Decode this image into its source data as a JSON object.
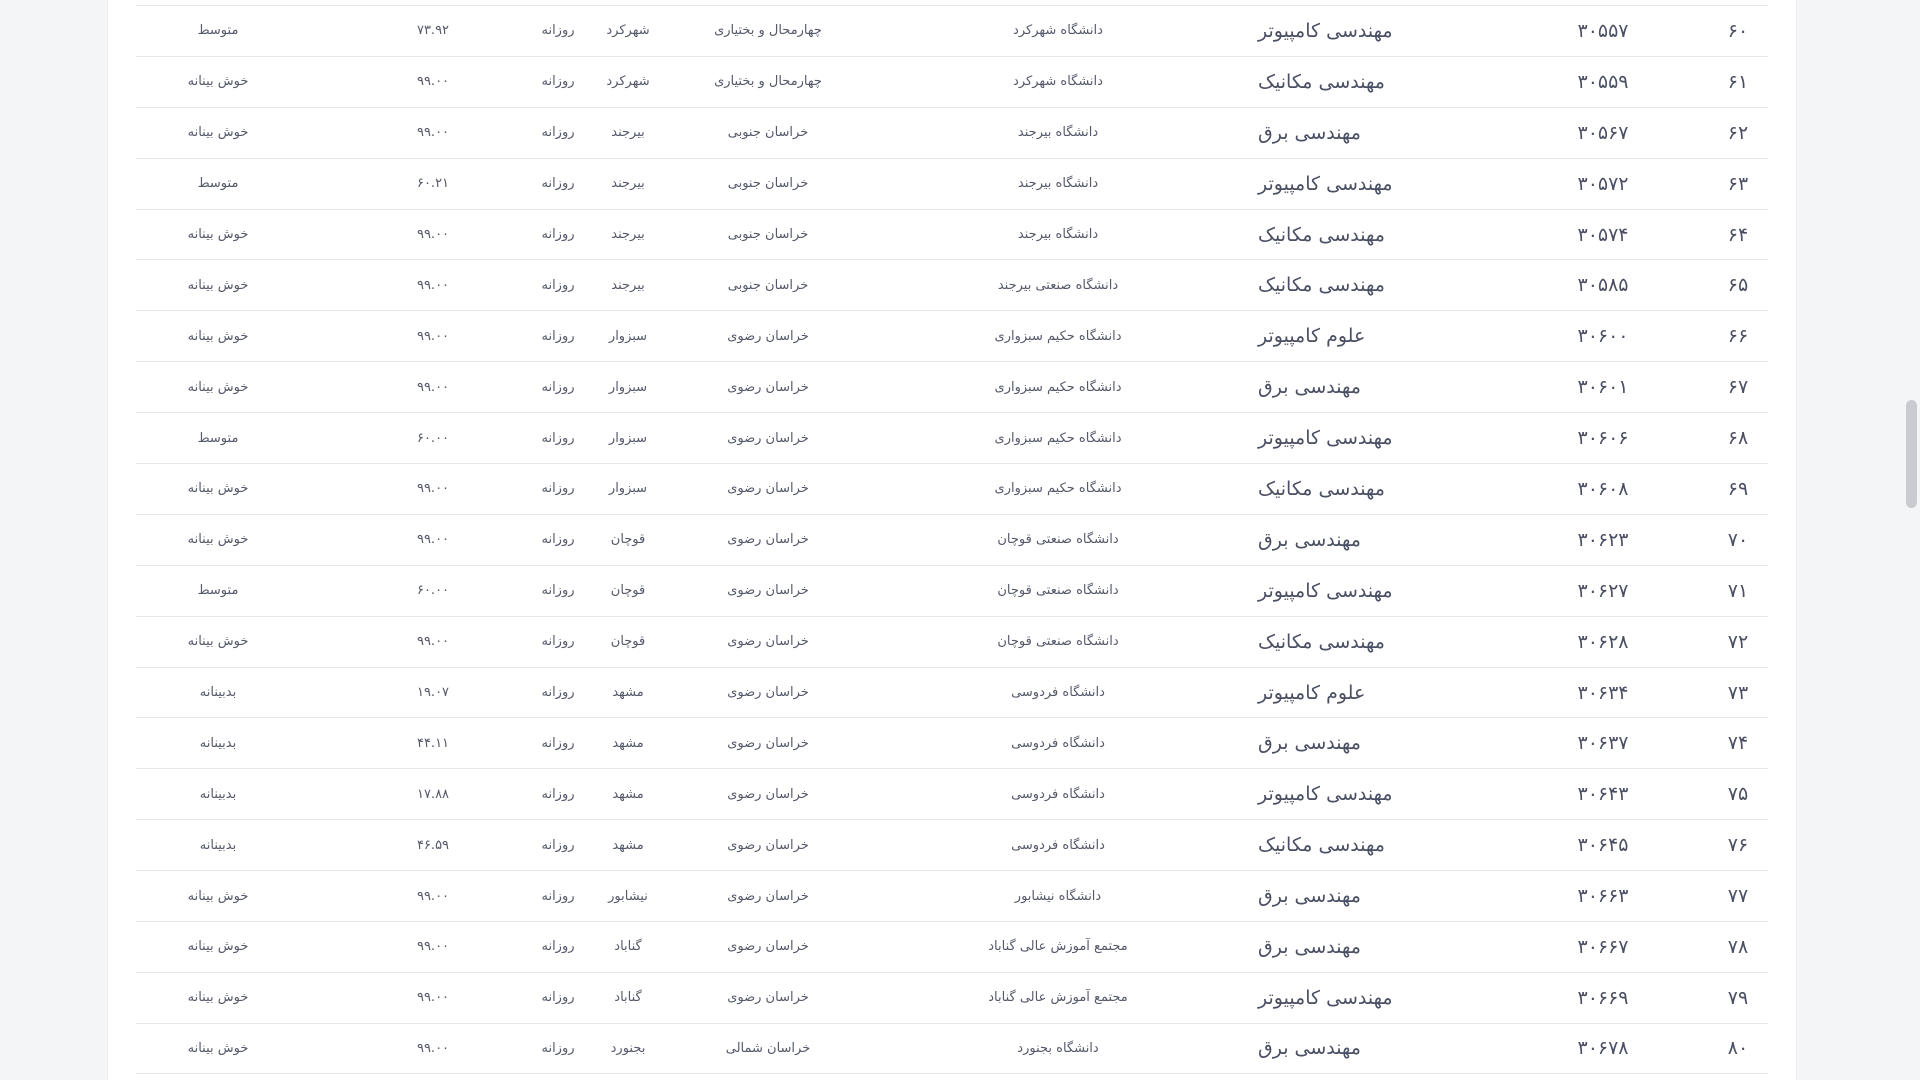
{
  "table": {
    "rows": [
      {
        "idx": "۶۰",
        "code": "۳۰۵۵۷",
        "field": "مهندسی کامپیوتر",
        "university": "دانشگاه شهرکرد",
        "province": "چهارمحال و بختیاری",
        "city": "شهرکرد",
        "type": "روزانه",
        "score": "۷۳.۹۲",
        "status": "متوسط"
      },
      {
        "idx": "۶۱",
        "code": "۳۰۵۵۹",
        "field": "مهندسی مکانیک",
        "university": "دانشگاه شهرکرد",
        "province": "چهارمحال و بختیاری",
        "city": "شهرکرد",
        "type": "روزانه",
        "score": "۹۹.۰۰",
        "status": "خوش بینانه"
      },
      {
        "idx": "۶۲",
        "code": "۳۰۵۶۷",
        "field": "مهندسی برق",
        "university": "دانشگاه بیرجند",
        "province": "خراسان جنوبی",
        "city": "بیرجند",
        "type": "روزانه",
        "score": "۹۹.۰۰",
        "status": "خوش بینانه"
      },
      {
        "idx": "۶۳",
        "code": "۳۰۵۷۲",
        "field": "مهندسی کامپیوتر",
        "university": "دانشگاه بیرجند",
        "province": "خراسان جنوبی",
        "city": "بیرجند",
        "type": "روزانه",
        "score": "۶۰.۲۱",
        "status": "متوسط"
      },
      {
        "idx": "۶۴",
        "code": "۳۰۵۷۴",
        "field": "مهندسی مکانیک",
        "university": "دانشگاه بیرجند",
        "province": "خراسان جنوبی",
        "city": "بیرجند",
        "type": "روزانه",
        "score": "۹۹.۰۰",
        "status": "خوش بینانه"
      },
      {
        "idx": "۶۵",
        "code": "۳۰۵۸۵",
        "field": "مهندسی مکانیک",
        "university": "دانشگاه صنعتی بیرجند",
        "province": "خراسان جنوبی",
        "city": "بیرجند",
        "type": "روزانه",
        "score": "۹۹.۰۰",
        "status": "خوش بینانه"
      },
      {
        "idx": "۶۶",
        "code": "۳۰۶۰۰",
        "field": "علوم کامپیوتر",
        "university": "دانشگاه حکیم سبزواری",
        "province": "خراسان رضوی",
        "city": "سبزوار",
        "type": "روزانه",
        "score": "۹۹.۰۰",
        "status": "خوش بینانه"
      },
      {
        "idx": "۶۷",
        "code": "۳۰۶۰۱",
        "field": "مهندسی برق",
        "university": "دانشگاه حکیم سبزواری",
        "province": "خراسان رضوی",
        "city": "سبزوار",
        "type": "روزانه",
        "score": "۹۹.۰۰",
        "status": "خوش بینانه"
      },
      {
        "idx": "۶۸",
        "code": "۳۰۶۰۶",
        "field": "مهندسی کامپیوتر",
        "university": "دانشگاه حکیم سبزواری",
        "province": "خراسان رضوی",
        "city": "سبزوار",
        "type": "روزانه",
        "score": "۶۰.۰۰",
        "status": "متوسط"
      },
      {
        "idx": "۶۹",
        "code": "۳۰۶۰۸",
        "field": "مهندسی مکانیک",
        "university": "دانشگاه حکیم سبزواری",
        "province": "خراسان رضوی",
        "city": "سبزوار",
        "type": "روزانه",
        "score": "۹۹.۰۰",
        "status": "خوش بینانه"
      },
      {
        "idx": "۷۰",
        "code": "۳۰۶۲۳",
        "field": "مهندسی برق",
        "university": "دانشگاه صنعتی قوچان",
        "province": "خراسان رضوی",
        "city": "قوچان",
        "type": "روزانه",
        "score": "۹۹.۰۰",
        "status": "خوش بینانه"
      },
      {
        "idx": "۷۱",
        "code": "۳۰۶۲۷",
        "field": "مهندسی کامپیوتر",
        "university": "دانشگاه صنعتی قوچان",
        "province": "خراسان رضوی",
        "city": "قوچان",
        "type": "روزانه",
        "score": "۶۰.۰۰",
        "status": "متوسط"
      },
      {
        "idx": "۷۲",
        "code": "۳۰۶۲۸",
        "field": "مهندسی مکانیک",
        "university": "دانشگاه صنعتی قوچان",
        "province": "خراسان رضوی",
        "city": "قوچان",
        "type": "روزانه",
        "score": "۹۹.۰۰",
        "status": "خوش بینانه"
      },
      {
        "idx": "۷۳",
        "code": "۳۰۶۳۴",
        "field": "علوم کامپیوتر",
        "university": "دانشگاه فردوسی",
        "province": "خراسان رضوی",
        "city": "مشهد",
        "type": "روزانه",
        "score": "۱۹.۰۷",
        "status": "بدبینانه"
      },
      {
        "idx": "۷۴",
        "code": "۳۰۶۳۷",
        "field": "مهندسی برق",
        "university": "دانشگاه فردوسی",
        "province": "خراسان رضوی",
        "city": "مشهد",
        "type": "روزانه",
        "score": "۴۴.۱۱",
        "status": "بدبینانه"
      },
      {
        "idx": "۷۵",
        "code": "۳۰۶۴۳",
        "field": "مهندسی کامپیوتر",
        "university": "دانشگاه فردوسی",
        "province": "خراسان رضوی",
        "city": "مشهد",
        "type": "روزانه",
        "score": "۱۷.۸۸",
        "status": "بدبینانه"
      },
      {
        "idx": "۷۶",
        "code": "۳۰۶۴۵",
        "field": "مهندسی مکانیک",
        "university": "دانشگاه فردوسی",
        "province": "خراسان رضوی",
        "city": "مشهد",
        "type": "روزانه",
        "score": "۴۶.۵۹",
        "status": "بدبینانه"
      },
      {
        "idx": "۷۷",
        "code": "۳۰۶۶۳",
        "field": "مهندسی برق",
        "university": "دانشگاه نیشابور",
        "province": "خراسان رضوی",
        "city": "نیشابور",
        "type": "روزانه",
        "score": "۹۹.۰۰",
        "status": "خوش بینانه"
      },
      {
        "idx": "۷۸",
        "code": "۳۰۶۶۷",
        "field": "مهندسی برق",
        "university": "مجتمع آموزش عالی گناباد",
        "province": "خراسان رضوی",
        "city": "گناباد",
        "type": "روزانه",
        "score": "۹۹.۰۰",
        "status": "خوش بینانه"
      },
      {
        "idx": "۷۹",
        "code": "۳۰۶۶۹",
        "field": "مهندسی کامپیوتر",
        "university": "مجتمع آموزش عالی گناباد",
        "province": "خراسان رضوی",
        "city": "گناباد",
        "type": "روزانه",
        "score": "۹۹.۰۰",
        "status": "خوش بینانه"
      },
      {
        "idx": "۸۰",
        "code": "۳۰۶۷۸",
        "field": "مهندسی برق",
        "university": "دانشگاه بجنورد",
        "province": "خراسان شمالی",
        "city": "بجنورد",
        "type": "روزانه",
        "score": "۹۹.۰۰",
        "status": "خوش بینانه"
      }
    ]
  },
  "scrollbar": {
    "position_fraction": 0.37,
    "visible_fraction": 0.1
  }
}
